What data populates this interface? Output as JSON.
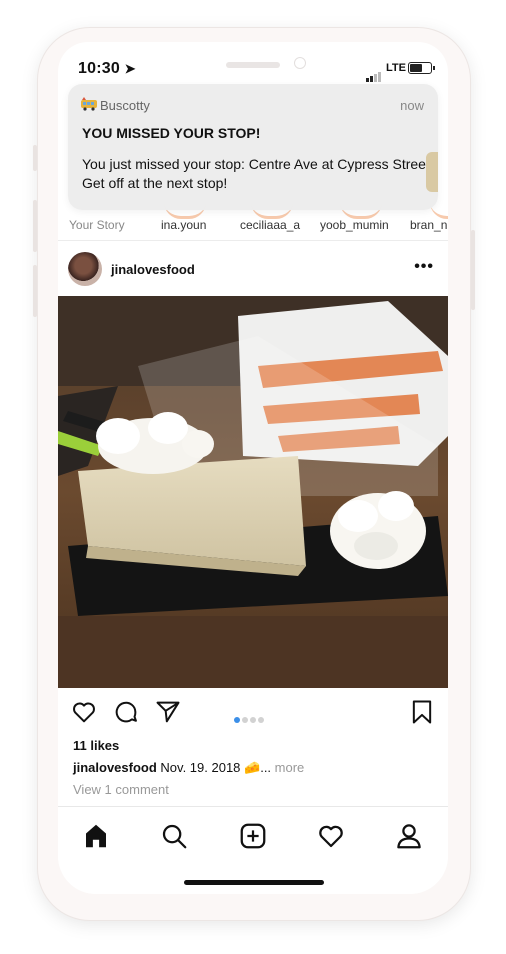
{
  "status_bar": {
    "time": "10:30",
    "network": "LTE"
  },
  "notification": {
    "app_name": "Buscotty",
    "time": "now",
    "title": "YOU MISSED YOUR STOP!",
    "body": "You just missed your stop: Centre Ave at Cypress Street. Get off at the next stop!"
  },
  "stories": [
    "Your Story",
    "ina.youn",
    "ceciliaaa_a",
    "yoob_mumin",
    "bran_n"
  ],
  "post": {
    "username": "jinalovesfood",
    "more_dots": "•••",
    "likes": "11 likes",
    "caption_user": "jinalovesfood",
    "caption_text": "Nov. 19. 2018 🧀...",
    "caption_more": "more",
    "view_comments": "View 1 comment",
    "carousel": {
      "count": 4,
      "active": 1
    }
  },
  "tab_bar": [
    "home-icon",
    "search-icon",
    "new-post-icon",
    "activity-heart-icon",
    "profile-icon"
  ],
  "colors": {
    "accent_blue": "#3b8fe8",
    "story_ring": "#f2a06b"
  }
}
